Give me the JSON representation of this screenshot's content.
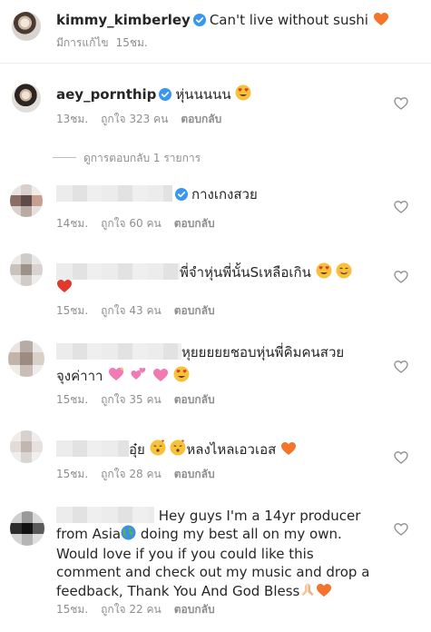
{
  "caption": {
    "username": "kimmy_kimberley",
    "text": "Can't live without sushi",
    "emoji": "orange-heart",
    "edited": "มีการแก้ไข",
    "time": "15ชม."
  },
  "comments": [
    {
      "username": "aey_pornthip",
      "text": "หุ่นนนนน",
      "time": "13ชม.",
      "likes": "ถูกใจ 323 คน",
      "reply": "ตอบกลับ",
      "view_replies": "ดูการตอบกลับ 1 รายการ"
    },
    {
      "text": "กางเกงสวย",
      "time": "14ชม.",
      "likes": "ถูกใจ 60 คน",
      "reply": "ตอบกลับ"
    },
    {
      "text": "พี่จำหุ่นพี่นั้นSเหลือเกิน",
      "time": "15ชม.",
      "likes": "ถูกใจ 43 คน",
      "reply": "ตอบกลับ"
    },
    {
      "text": "หุยยยยยชอบหุ่นพี่คิมคนสวย",
      "text2": "จุงค่าาา",
      "time": "15ชม.",
      "likes": "ถูกใจ 35 คน",
      "reply": "ตอบกลับ"
    },
    {
      "text_a": "อุ๋ย",
      "text_b": "หลงไหลเอวเอส",
      "time": "15ชม.",
      "likes": "ถูกใจ 28 คน",
      "reply": "ตอบกลับ"
    },
    {
      "line1": "Hey guys I'm a 14yr producer",
      "line2a": "from Asia",
      "line2b": " doing my best all on my own.",
      "line3": "Would love if you if you could like this",
      "line4": "comment and check out my music and drop a",
      "line5": "feedback, Thank You And God Bless",
      "time": "15ชม.",
      "likes": "ถูกใจ 22 คน",
      "reply": "ตอบกลับ"
    }
  ],
  "colors": {
    "text": "#262626",
    "meta": "#8e8e8e",
    "verified": "#3897f0",
    "heart_emoji": "#f4742b",
    "red_heart": "#e0392d",
    "pink_heart": "#f27ab4",
    "smiley": "#f7c23a"
  }
}
